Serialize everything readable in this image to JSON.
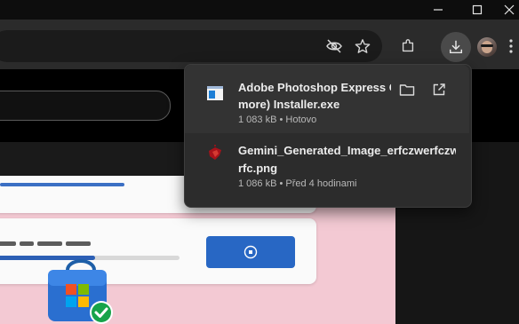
{
  "window": {
    "minimize_label": "–",
    "maximize_label": "□",
    "close_label": "✕"
  },
  "toolbar": {
    "icons": [
      "eye-off-icon",
      "star-icon",
      "extensions-icon",
      "download-icon",
      "profile-avatar"
    ]
  },
  "downloads": {
    "items": [
      {
        "name_line1": "Adobe Photoshop Express Cl",
        "name_line2": "more) Installer.exe",
        "meta": "1 083 kB • Hotovo",
        "icon": "installer-icon"
      },
      {
        "name_line1": "Gemini_Generated_Image_erfczwerfczwe",
        "name_line2": "rfc.png",
        "meta": "1 086 kB • Před 4 hodinami",
        "icon": "image-file-icon"
      }
    ]
  },
  "page": {
    "install_progress": 0.55,
    "colors": {
      "accent_blue": "#2867c4",
      "page_pink": "#f3c9d3",
      "success_green": "#17a34a"
    }
  }
}
